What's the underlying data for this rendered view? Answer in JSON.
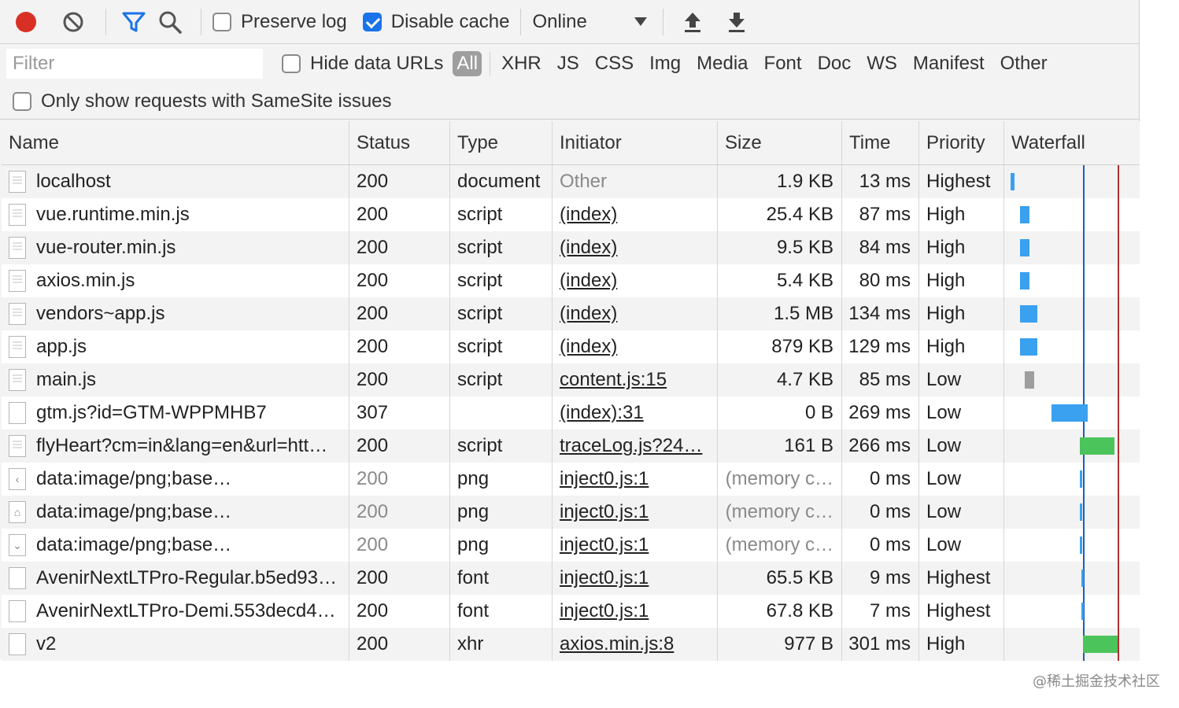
{
  "toolbar": {
    "preserve_log": "Preserve log",
    "disable_cache": "Disable cache",
    "throttling": "Online",
    "icons": [
      "record-icon",
      "clear-icon",
      "filter-icon",
      "search-icon",
      "import-icon",
      "export-icon"
    ],
    "record_color": "#d93025",
    "filter_color": "#1a73e8"
  },
  "filter": {
    "placeholder": "Filter",
    "hide_data_urls": "Hide data URLs",
    "types": [
      "All",
      "XHR",
      "JS",
      "CSS",
      "Img",
      "Media",
      "Font",
      "Doc",
      "WS",
      "Manifest",
      "Other"
    ],
    "samesite": "Only show requests with SameSite issues"
  },
  "columns": [
    "Name",
    "Status",
    "Type",
    "Initiator",
    "Size",
    "Time",
    "Priority",
    "Waterfall"
  ],
  "rows": [
    {
      "name": "localhost",
      "status": "200",
      "type": "document",
      "initiator": "Other",
      "size": "1.9 KB",
      "time": "13 ms",
      "priority": "Highest"
    },
    {
      "name": "vue.runtime.min.js",
      "status": "200",
      "type": "script",
      "initiator": "(index)",
      "size": "25.4 KB",
      "time": "87 ms",
      "priority": "High"
    },
    {
      "name": "vue-router.min.js",
      "status": "200",
      "type": "script",
      "initiator": "(index)",
      "size": "9.5 KB",
      "time": "84 ms",
      "priority": "High"
    },
    {
      "name": "axios.min.js",
      "status": "200",
      "type": "script",
      "initiator": "(index)",
      "size": "5.4 KB",
      "time": "80 ms",
      "priority": "High"
    },
    {
      "name": "vendors~app.js",
      "status": "200",
      "type": "script",
      "initiator": "(index)",
      "size": "1.5 MB",
      "time": "134 ms",
      "priority": "High"
    },
    {
      "name": "app.js",
      "status": "200",
      "type": "script",
      "initiator": "(index)",
      "size": "879 KB",
      "time": "129 ms",
      "priority": "High"
    },
    {
      "name": "main.js",
      "status": "200",
      "type": "script",
      "initiator": "content.js:15",
      "size": "4.7 KB",
      "time": "85 ms",
      "priority": "Low"
    },
    {
      "name": "gtm.js?id=GTM-WPPMHB7",
      "status": "307",
      "type": "",
      "initiator": "(index):31",
      "size": "0 B",
      "time": "269 ms",
      "priority": "Low"
    },
    {
      "name": "flyHeart?cm=in&lang=en&url=htt…",
      "status": "200",
      "type": "script",
      "initiator": "traceLog.js?24…",
      "size": "161 B",
      "time": "266 ms",
      "priority": "Low"
    },
    {
      "name": "data:image/png;base…",
      "status": "200",
      "type": "png",
      "initiator": "inject0.js:1",
      "size": "(memory c…",
      "time": "0 ms",
      "priority": "Low"
    },
    {
      "name": "data:image/png;base…",
      "status": "200",
      "type": "png",
      "initiator": "inject0.js:1",
      "size": "(memory c…",
      "time": "0 ms",
      "priority": "Low"
    },
    {
      "name": "data:image/png;base…",
      "status": "200",
      "type": "png",
      "initiator": "inject0.js:1",
      "size": "(memory c…",
      "time": "0 ms",
      "priority": "Low"
    },
    {
      "name": "AvenirNextLTPro-Regular.b5ed93…",
      "status": "200",
      "type": "font",
      "initiator": "inject0.js:1",
      "size": "65.5 KB",
      "time": "9 ms",
      "priority": "Highest"
    },
    {
      "name": "AvenirNextLTPro-Demi.553decd4…",
      "status": "200",
      "type": "font",
      "initiator": "inject0.js:1",
      "size": "67.8 KB",
      "time": "7 ms",
      "priority": "Highest"
    },
    {
      "name": "v2",
      "status": "200",
      "type": "xhr",
      "initiator": "axios.min.js:8",
      "size": "977 B",
      "time": "301 ms",
      "priority": "High"
    }
  ],
  "watermark": "@稀土掘金技术社区"
}
